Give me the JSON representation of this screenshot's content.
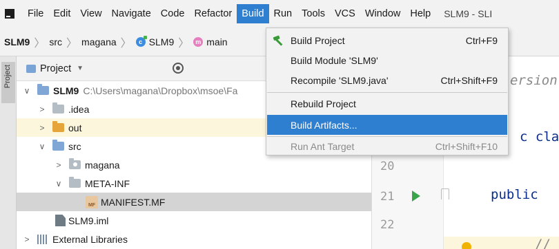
{
  "menubar": {
    "items": [
      "File",
      "Edit",
      "View",
      "Navigate",
      "Code",
      "Refactor",
      "Build",
      "Run",
      "Tools",
      "VCS",
      "Window",
      "Help"
    ],
    "active_index": 6,
    "window_title": "SLM9 - SLI"
  },
  "breadcrumb": [
    "SLM9",
    "src",
    "magana",
    "SLM9",
    "main"
  ],
  "side_strip": {
    "label": "Project"
  },
  "project_panel": {
    "header_label": "Project",
    "dropdown_glyph": "▼",
    "tree": [
      {
        "name": "SLM9",
        "path": "C:\\Users\\magana\\Dropbox\\msoe\\Fa",
        "expanded": true,
        "bold": true
      },
      {
        "name": ".idea",
        "expanded": false
      },
      {
        "name": "out",
        "expanded": false
      },
      {
        "name": "src",
        "expanded": true
      },
      {
        "name": "magana",
        "expanded": false
      },
      {
        "name": "META-INF",
        "expanded": true
      },
      {
        "name": "MANIFEST.MF"
      },
      {
        "name": "SLM9.iml"
      },
      {
        "name": "External Libraries",
        "expanded": false
      }
    ]
  },
  "editor": {
    "line_numbers": [
      "20",
      "21",
      "22"
    ],
    "code_fragments": [
      "ersion",
      "c clas",
      "public",
      "//"
    ]
  },
  "build_menu": {
    "items": [
      {
        "label": "Build Project",
        "shortcut": "Ctrl+F9"
      },
      {
        "label": "Build Module 'SLM9'",
        "shortcut": ""
      },
      {
        "label": "Recompile 'SLM9.java'",
        "shortcut": "Ctrl+Shift+F9"
      },
      {
        "label": "Rebuild Project",
        "shortcut": ""
      },
      {
        "label": "Build Artifacts...",
        "shortcut": ""
      },
      {
        "label": "Run Ant Target",
        "shortcut": "Ctrl+Shift+F10"
      }
    ],
    "active_index": 4,
    "disabled_index": 5
  },
  "colors": {
    "menu_highlight": "#2f7fd1",
    "run_green": "#3ba349",
    "hammer_green": "#3a9a3a"
  }
}
